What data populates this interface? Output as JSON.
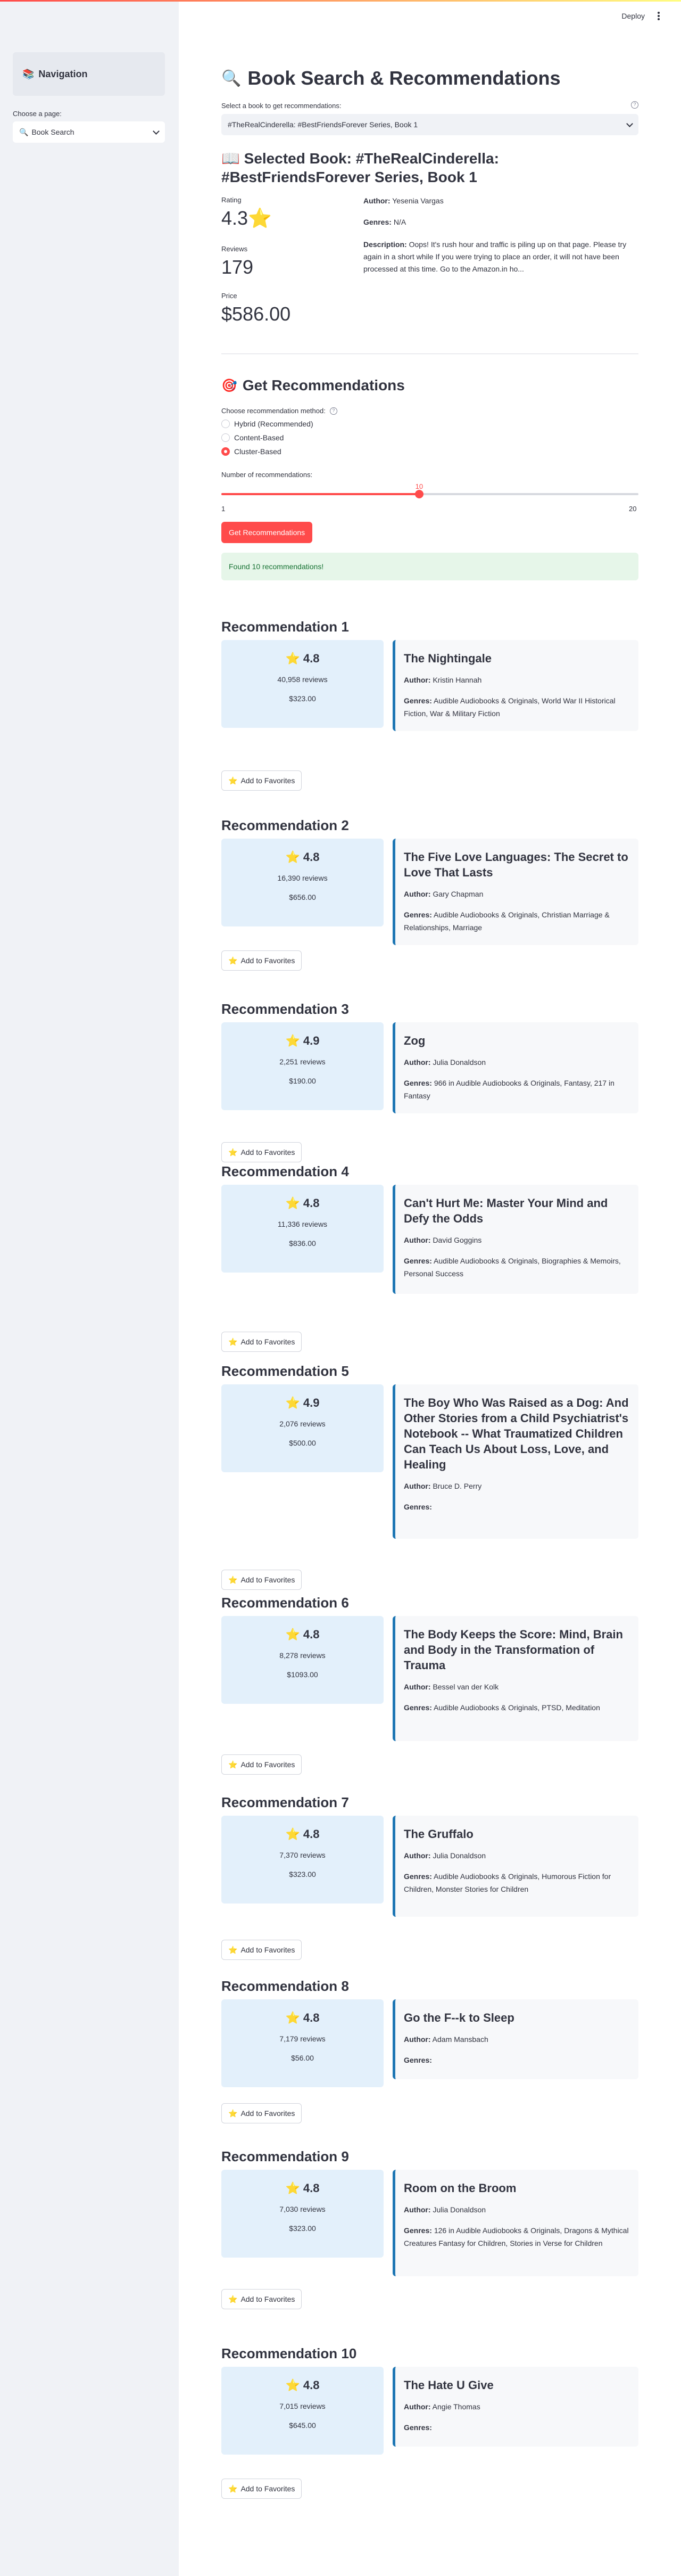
{
  "app": {
    "deploy_label": "Deploy"
  },
  "sidebar": {
    "nav_title": "Navigation",
    "page_label": "Choose a page:",
    "page_value": "Book Search"
  },
  "search": {
    "title": "Book Search & Recommendations",
    "select_label": "Select a book to get recommendations:",
    "select_value": "#TheRealCinderella: #BestFriendsForever Series, Book 1"
  },
  "selected": {
    "title": "Selected Book: #TheRealCinderella: #BestFriendsForever Series, Book 1",
    "rating_label": "Rating",
    "rating": "4.3",
    "reviews_label": "Reviews",
    "reviews": "179",
    "price_label": "Price",
    "price": "$586.00",
    "author_label": "Author:",
    "author": "Yesenia Vargas",
    "genres_label": "Genres:",
    "genres": "N/A",
    "description_label": "Description:",
    "description": "Oops! It's rush hour and traffic is piling up on that page. Please try again in a short while If you were trying to place an order, it will not have been processed at this time. Go to the Amazon.in ho..."
  },
  "recommend": {
    "heading": "Get Recommendations",
    "method_label": "Choose recommendation method:",
    "methods": [
      "Hybrid (Recommended)",
      "Content-Based",
      "Cluster-Based"
    ],
    "selected_method": 2,
    "slider_label": "Number of recommendations:",
    "slider_value": "10",
    "slider_min": "1",
    "slider_max": "20",
    "slider_fraction": 0.474,
    "button_label": "Get Recommendations",
    "success_message": "Found 10 recommendations!"
  },
  "labels": {
    "author": "Author:",
    "genres": "Genres:",
    "favorite": "Add to Favorites"
  },
  "recs": [
    {
      "heading": "Recommendation 1",
      "rating": "4.8",
      "reviews": "40,958 reviews",
      "price": "$323.00",
      "title": "The Nightingale",
      "author": "Kristin Hannah",
      "genres": "Audible Audiobooks & Originals, World War II Historical Fiction, War & Military Fiction"
    },
    {
      "heading": "Recommendation 2",
      "rating": "4.8",
      "reviews": "16,390 reviews",
      "price": "$656.00",
      "title": "The Five Love Languages: The Secret to Love That Lasts",
      "author": "Gary Chapman",
      "genres": "Audible Audiobooks & Originals, Christian Marriage & Relationships, Marriage"
    },
    {
      "heading": "Recommendation 3",
      "rating": "4.9",
      "reviews": "2,251 reviews",
      "price": "$190.00",
      "title": "Zog",
      "author": "Julia Donaldson",
      "genres": "966 in Audible Audiobooks & Originals, Fantasy, 217 in Fantasy"
    },
    {
      "heading": "Recommendation 4",
      "rating": "4.8",
      "reviews": "11,336 reviews",
      "price": "$836.00",
      "title": "Can't Hurt Me: Master Your Mind and Defy the Odds",
      "author": "David Goggins",
      "genres": "Audible Audiobooks & Originals, Biographies & Memoirs, Personal Success"
    },
    {
      "heading": "Recommendation 5",
      "rating": "4.9",
      "reviews": "2,076 reviews",
      "price": "$500.00",
      "title": "The Boy Who Was Raised as a Dog: And Other Stories from a Child Psychiatrist's Notebook -- What Traumatized Children Can Teach Us About Loss, Love, and Healing",
      "author": "Bruce D. Perry",
      "genres": ""
    },
    {
      "heading": "Recommendation 6",
      "rating": "4.8",
      "reviews": "8,278 reviews",
      "price": "$1093.00",
      "title": "The Body Keeps the Score: Mind, Brain and Body in the Transformation of Trauma",
      "author": "Bessel van der Kolk",
      "genres": "Audible Audiobooks & Originals, PTSD, Meditation"
    },
    {
      "heading": "Recommendation 7",
      "rating": "4.8",
      "reviews": "7,370 reviews",
      "price": "$323.00",
      "title": "The Gruffalo",
      "author": "Julia Donaldson",
      "genres": "Audible Audiobooks & Originals, Humorous Fiction for Children, Monster Stories for Children"
    },
    {
      "heading": "Recommendation 8",
      "rating": "4.8",
      "reviews": "7,179 reviews",
      "price": "$56.00",
      "title": "Go the F--k to Sleep",
      "author": "Adam Mansbach",
      "genres": ""
    },
    {
      "heading": "Recommendation 9",
      "rating": "4.8",
      "reviews": "7,030 reviews",
      "price": "$323.00",
      "title": "Room on the Broom",
      "author": "Julia Donaldson",
      "genres": "126 in Audible Audiobooks & Originals, Dragons & Mythical Creatures Fantasy for Children, Stories in Verse for Children"
    },
    {
      "heading": "Recommendation 10",
      "rating": "4.8",
      "reviews": "7,015 reviews",
      "price": "$645.00",
      "title": "The Hate U Give",
      "author": "Angie Thomas",
      "genres": ""
    }
  ]
}
